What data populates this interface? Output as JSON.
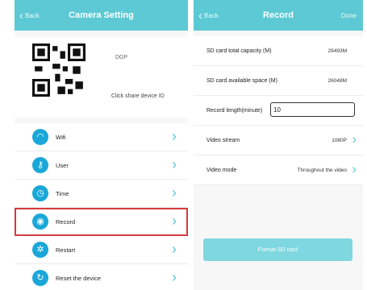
{
  "left": {
    "nav": {
      "back_label": "Back",
      "title": "Camera Setting"
    },
    "qr": {
      "device_id": "DGP",
      "share_label": "Click share device ID"
    },
    "menu": [
      {
        "label": "Wifi",
        "icon": "wifi-icon"
      },
      {
        "label": "User",
        "icon": "key-icon"
      },
      {
        "label": "Time",
        "icon": "clock-icon"
      },
      {
        "label": "Record",
        "icon": "record-icon"
      },
      {
        "label": "Restart",
        "icon": "restart-icon"
      },
      {
        "label": "Reset the device",
        "icon": "reset-icon"
      }
    ]
  },
  "right": {
    "nav": {
      "back_label": "Back",
      "title": "Record",
      "done_label": "Done"
    },
    "sd_total_label": "SD card total capacity (M)",
    "sd_total_value": "29493M",
    "sd_available_label": "SD card available space (M)",
    "sd_available_value": "26048M",
    "record_length_label": "Record length(minute)",
    "record_length_value": "10",
    "video_stream_label": "Video stream",
    "video_stream_value": "1080P",
    "video_mode_label": "Video mode",
    "video_mode_value": "Throughout the video",
    "format_label": "Format SD card"
  },
  "colors": {
    "nav": "#5cc9d4",
    "icon_blue": "#1aa7d8",
    "highlight": "#d53a3a",
    "format_button": "#7fd7df"
  }
}
